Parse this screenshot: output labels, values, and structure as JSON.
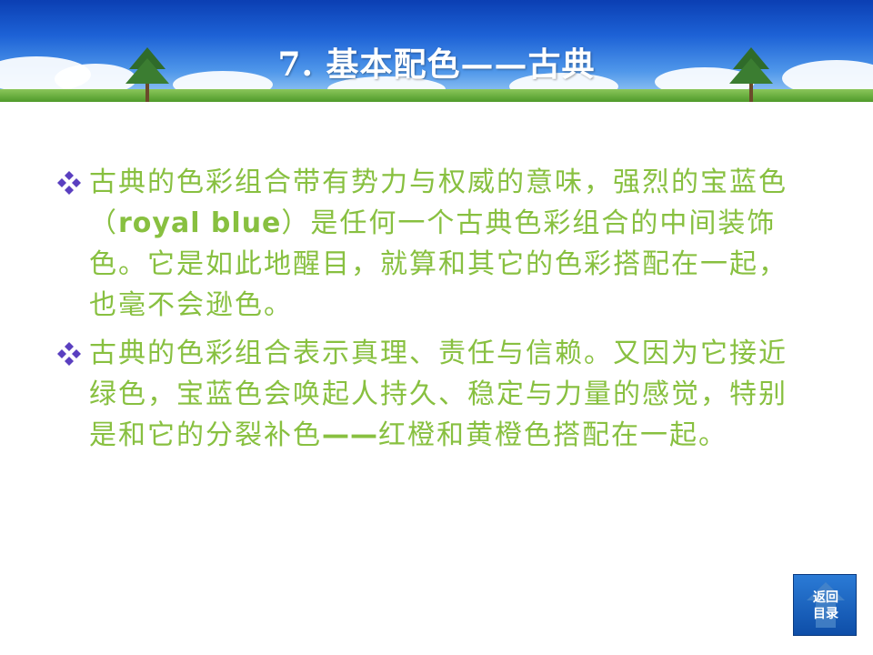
{
  "slide": {
    "title": "7. 基本配色——古典",
    "bullets": [
      {
        "segments": [
          {
            "text": "古典的色彩组合带有势力与权威的意味，强烈的宝蓝色（",
            "bold": false
          },
          {
            "text": "royal blue",
            "bold": true
          },
          {
            "text": "）是任何一个古典色彩组合的中间装饰色。它是如此地醒目，就算和其它的色彩搭配在一起，也毫不会逊色。",
            "bold": false
          }
        ]
      },
      {
        "segments": [
          {
            "text": "古典的色彩组合表示真理、责任与信赖。又因为它接近绿色，宝蓝色会唤起人持久、稳定与力量的感觉，特别是和它的分裂补色",
            "bold": false
          },
          {
            "text": "——",
            "bold": true
          },
          {
            "text": "红橙和黄橙色搭配在一起。",
            "bold": false
          }
        ]
      }
    ],
    "nav_button": {
      "label": "返回\n目录"
    }
  },
  "colors": {
    "body_text": "#88c040",
    "bullet_mark": "#5a3fc0",
    "header_sky": "#1d62d6"
  },
  "icons": {
    "bullet": "diamond-cluster-icon",
    "nav": "home-arrow-icon"
  }
}
